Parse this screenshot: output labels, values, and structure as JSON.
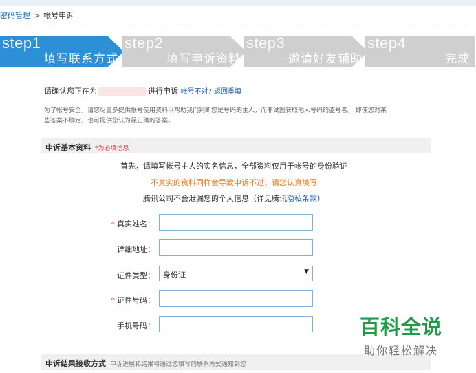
{
  "breadcrumb": {
    "parent": "密码管理",
    "separator": ">",
    "current": "帐号申诉"
  },
  "steps": [
    {
      "big": "step1",
      "title": "填写联系方式",
      "active": true
    },
    {
      "big": "step2",
      "title": "填写申诉资料",
      "active": false
    },
    {
      "big": "step3",
      "title": "邀请好友辅助",
      "active": false
    },
    {
      "big": "step4",
      "title": "完成",
      "active": false
    }
  ],
  "confirm": {
    "prefix": "请确认您正在为",
    "suffix": "进行申诉",
    "link": "帐号不对? 返回重填"
  },
  "note": "为了帐号安全，请您尽量多提供帐号使用资料以帮助我们判断您是号码的主人，而非试图获取他人号码的盗号者。 即使您对某些答案不确定，也可提供您认为最正确的答案。",
  "section1": {
    "title": "申诉基本资料",
    "required_note": "*为必填信息"
  },
  "info": {
    "line1": "首先，请填写帐号主人的实名信息，全部资料仅用于帐号的身份验证",
    "line2": "不真实的资料同样会导致申诉不过，请您认真填写",
    "line3_prefix": "腾讯公司不会泄漏您的个人信息（详见腾讯",
    "line3_link": "隐私条款",
    "line3_suffix": "）"
  },
  "form": {
    "required_mark": "*",
    "realname_label": "真实姓名：",
    "address_label": "详细地址：",
    "idtype_label": "证件类型：",
    "idtype_value": "身份证",
    "idnumber_label": "证件号码：",
    "phone_label": "手机号码："
  },
  "section2": {
    "title": "申诉结果接收方式",
    "subtitle": "申诉进展和结果将通过您填写的联系方式通知到您"
  },
  "watermark": {
    "title": "百科全说",
    "subtitle": "助你轻松解决"
  }
}
